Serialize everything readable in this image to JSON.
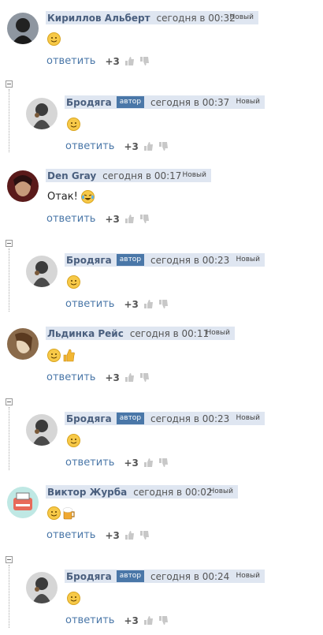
{
  "labels": {
    "reply": "ответить",
    "new": "Новый",
    "author_badge": "автор",
    "score": "+3"
  },
  "comments": [
    {
      "author": "Кириллов Альберт",
      "date": "сегодня в 00:32",
      "text": "",
      "emojis": [
        "smile"
      ],
      "avatar": "dark-hood"
    },
    {
      "author": "Бродяга",
      "date": "сегодня в 00:37",
      "text": "",
      "emojis": [
        "smile"
      ],
      "avatar": "grey-figure",
      "is_author": true
    },
    {
      "author": "Den Gray",
      "date": "сегодня в 00:17",
      "text": "Отак!",
      "emojis": [
        "tears-of-joy"
      ],
      "avatar": "red-face"
    },
    {
      "author": "Бродяга",
      "date": "сегодня в 00:23",
      "text": "",
      "emojis": [
        "smile"
      ],
      "avatar": "grey-figure",
      "is_author": true
    },
    {
      "author": "Льдинка Рейс",
      "date": "сегодня в 00:11",
      "text": "",
      "emojis": [
        "smile",
        "thumbs-up"
      ],
      "avatar": "sepia-face"
    },
    {
      "author": "Бродяга",
      "date": "сегодня в 00:23",
      "text": "",
      "emojis": [
        "smile"
      ],
      "avatar": "grey-figure",
      "is_author": true
    },
    {
      "author": "Виктор Журба",
      "date": "сегодня в 00:02",
      "text": "",
      "emojis": [
        "smile",
        "beer"
      ],
      "avatar": "teal-cartoon"
    },
    {
      "author": "Бродяга",
      "date": "сегодня в 00:24",
      "text": "",
      "emojis": [
        "smile"
      ],
      "avatar": "grey-figure",
      "is_author": true
    }
  ]
}
